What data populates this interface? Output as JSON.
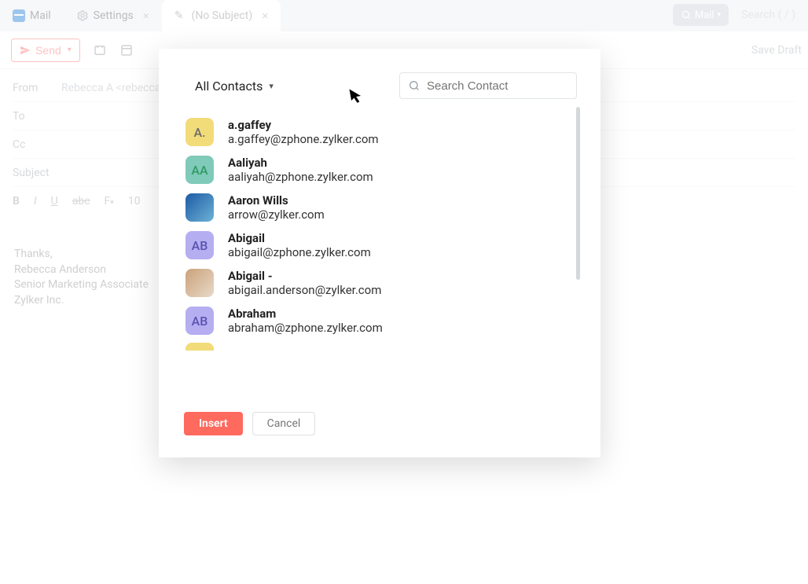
{
  "tabs": {
    "mail": "Mail",
    "settings": "Settings",
    "compose": "(No Subject)"
  },
  "topbar": {
    "mail_button": "Mail",
    "search": "Search ( / )"
  },
  "toolbar": {
    "send": "Send",
    "save_draft": "Save Draft"
  },
  "compose": {
    "from_label": "From",
    "from_value": "Rebecca A <rebecca@zylker.com>",
    "to_label": "To",
    "cc_label": "Cc",
    "subject_label": "Subject",
    "font_size": "10"
  },
  "signature": {
    "l1": "Thanks,",
    "l2": "Rebecca Anderson",
    "l3": "Senior Marketing Associate",
    "l4": "Zylker Inc."
  },
  "modal": {
    "filter": "All Contacts",
    "search_placeholder": "Search Contact",
    "insert": "Insert",
    "cancel": "Cancel",
    "contacts": [
      {
        "initials": "A.",
        "style": "av-yellow",
        "name": "a.gaffey",
        "email": "a.gaffey@zphone.zylker.com"
      },
      {
        "initials": "AA",
        "style": "av-teal",
        "name": "Aaliyah",
        "email": "aaliyah@zphone.zylker.com"
      },
      {
        "initials": "",
        "style": "av-photo1",
        "name": "Aaron Wills",
        "email": "arrow@zylker.com"
      },
      {
        "initials": "AB",
        "style": "av-purple",
        "name": "Abigail",
        "email": "abigail@zphone.zylker.com"
      },
      {
        "initials": "",
        "style": "av-photo2",
        "name": "Abigail -",
        "email": "abigail.anderson@zylker.com"
      },
      {
        "initials": "AB",
        "style": "av-purple",
        "name": "Abraham",
        "email": "abraham@zphone.zylker.com"
      }
    ]
  }
}
